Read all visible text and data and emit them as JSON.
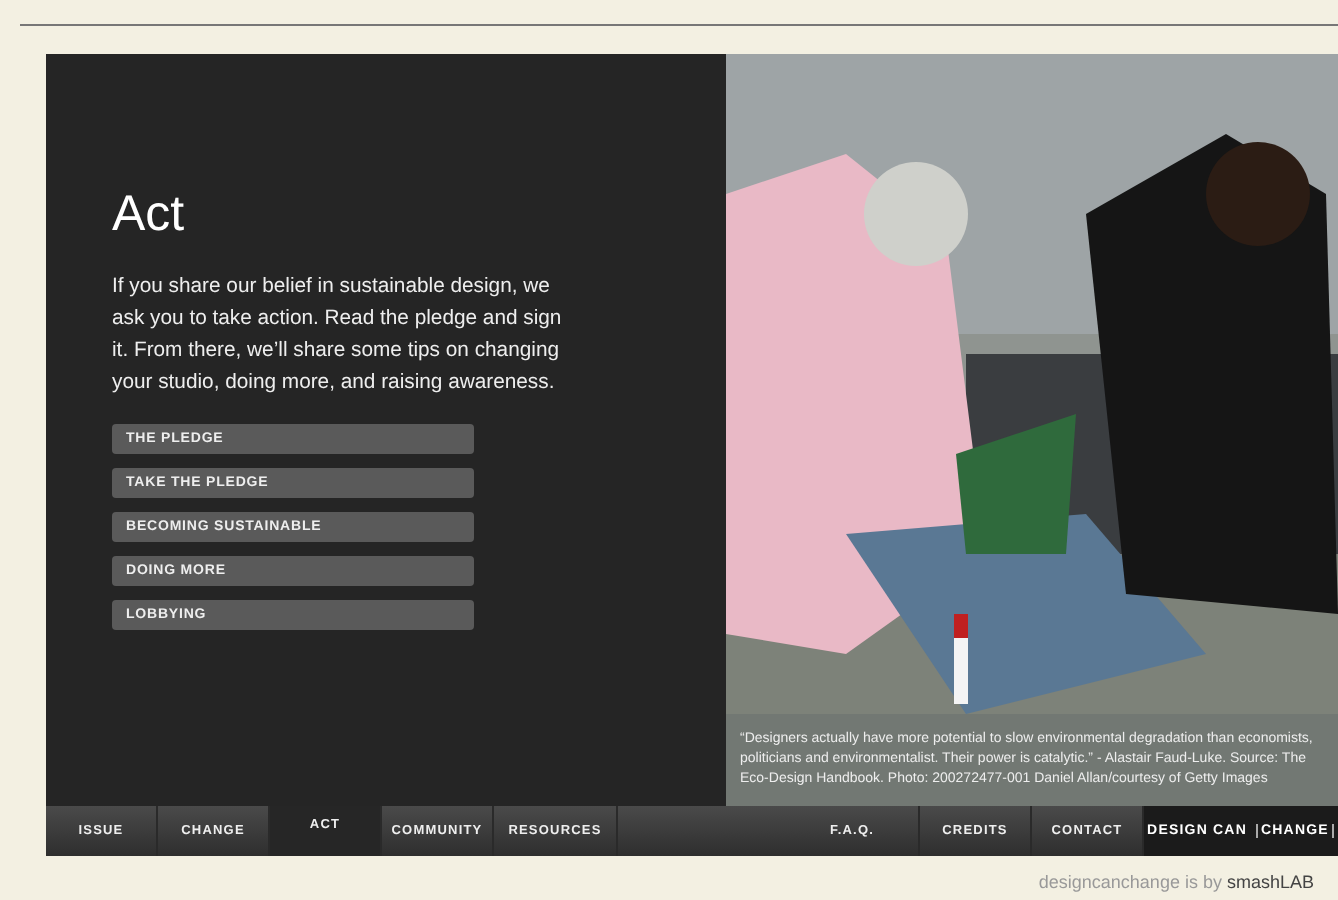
{
  "content": {
    "title": "Act",
    "intro": "If you share our belief in sustainable design, we ask you to take action. Read the pledge and sign it. From there, we’ll share some tips on changing your studio, doing more, and raising awareness.",
    "links": [
      "THE PLEDGE",
      "TAKE THE PLEDGE",
      "BECOMING SUSTAINABLE",
      "DOING MORE",
      "LOBBYING"
    ]
  },
  "photo": {
    "caption": "“Designers actually have more potential to slow environmental degradation than economists, politicians and environmentalist. Their power is catalytic.” - Alastair Faud-Luke. Source: The Eco-Design Handbook. Photo: 200272477-001 Daniel Allan/courtesy of Getty Images"
  },
  "nav": {
    "left": [
      {
        "label": "ISSUE",
        "selected": false
      },
      {
        "label": "CHANGE",
        "selected": false
      },
      {
        "label": "ACT",
        "selected": true
      },
      {
        "label": "COMMUNITY",
        "selected": false
      },
      {
        "label": "RESOURCES",
        "selected": false
      }
    ],
    "right": [
      {
        "label": "F.A.Q.",
        "selected": false
      },
      {
        "label": "CREDITS",
        "selected": false
      },
      {
        "label": "CONTACT",
        "selected": false
      }
    ],
    "logo": {
      "text": "DESIGN CAN",
      "mirrored_text": "CHANGE"
    }
  },
  "footer": "designcanchange is by **smashLAB**"
}
